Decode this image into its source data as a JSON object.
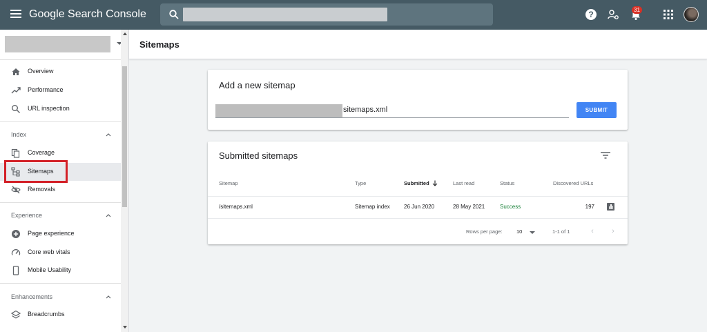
{
  "header": {
    "logo": "Google Search Console",
    "notification_count": "31",
    "help_glyph": "?"
  },
  "sidebar": {
    "items": [
      {
        "label": "Overview",
        "icon": "home-icon"
      },
      {
        "label": "Performance",
        "icon": "trending-up-icon"
      },
      {
        "label": "URL inspection",
        "icon": "search-icon"
      }
    ],
    "sections": [
      {
        "label": "Index",
        "items": [
          {
            "label": "Coverage",
            "icon": "file-copy-icon"
          },
          {
            "label": "Sitemaps",
            "icon": "sitemap-icon",
            "active": true
          },
          {
            "label": "Removals",
            "icon": "visibility-off-icon"
          }
        ]
      },
      {
        "label": "Experience",
        "items": [
          {
            "label": "Page experience",
            "icon": "add-circle-icon"
          },
          {
            "label": "Core web vitals",
            "icon": "speed-icon"
          },
          {
            "label": "Mobile Usability",
            "icon": "smartphone-icon"
          }
        ]
      },
      {
        "label": "Enhancements",
        "items": [
          {
            "label": "Breadcrumbs",
            "icon": "layers-icon"
          }
        ]
      }
    ]
  },
  "page": {
    "title": "Sitemaps"
  },
  "add_sitemap": {
    "title": "Add a new sitemap",
    "input_value": "sitemaps.xml",
    "submit_label": "SUBMIT"
  },
  "submitted": {
    "title": "Submitted sitemaps",
    "columns": [
      "Sitemap",
      "Type",
      "Submitted",
      "Last read",
      "Status",
      "Discovered URLs"
    ],
    "rows": [
      {
        "sitemap": "/sitemaps.xml",
        "type": "Sitemap index",
        "submitted": "26 Jun 2020",
        "last_read": "28 May 2021",
        "status": "Success",
        "discovered": "197"
      }
    ],
    "pager": {
      "rows_per_page_label": "Rows per page:",
      "rows_per_page": "10",
      "range": "1-1 of 1"
    }
  },
  "colors": {
    "topbar": "#455a64",
    "accent": "#4285f4",
    "success": "#188038",
    "highlight": "#d32027"
  }
}
